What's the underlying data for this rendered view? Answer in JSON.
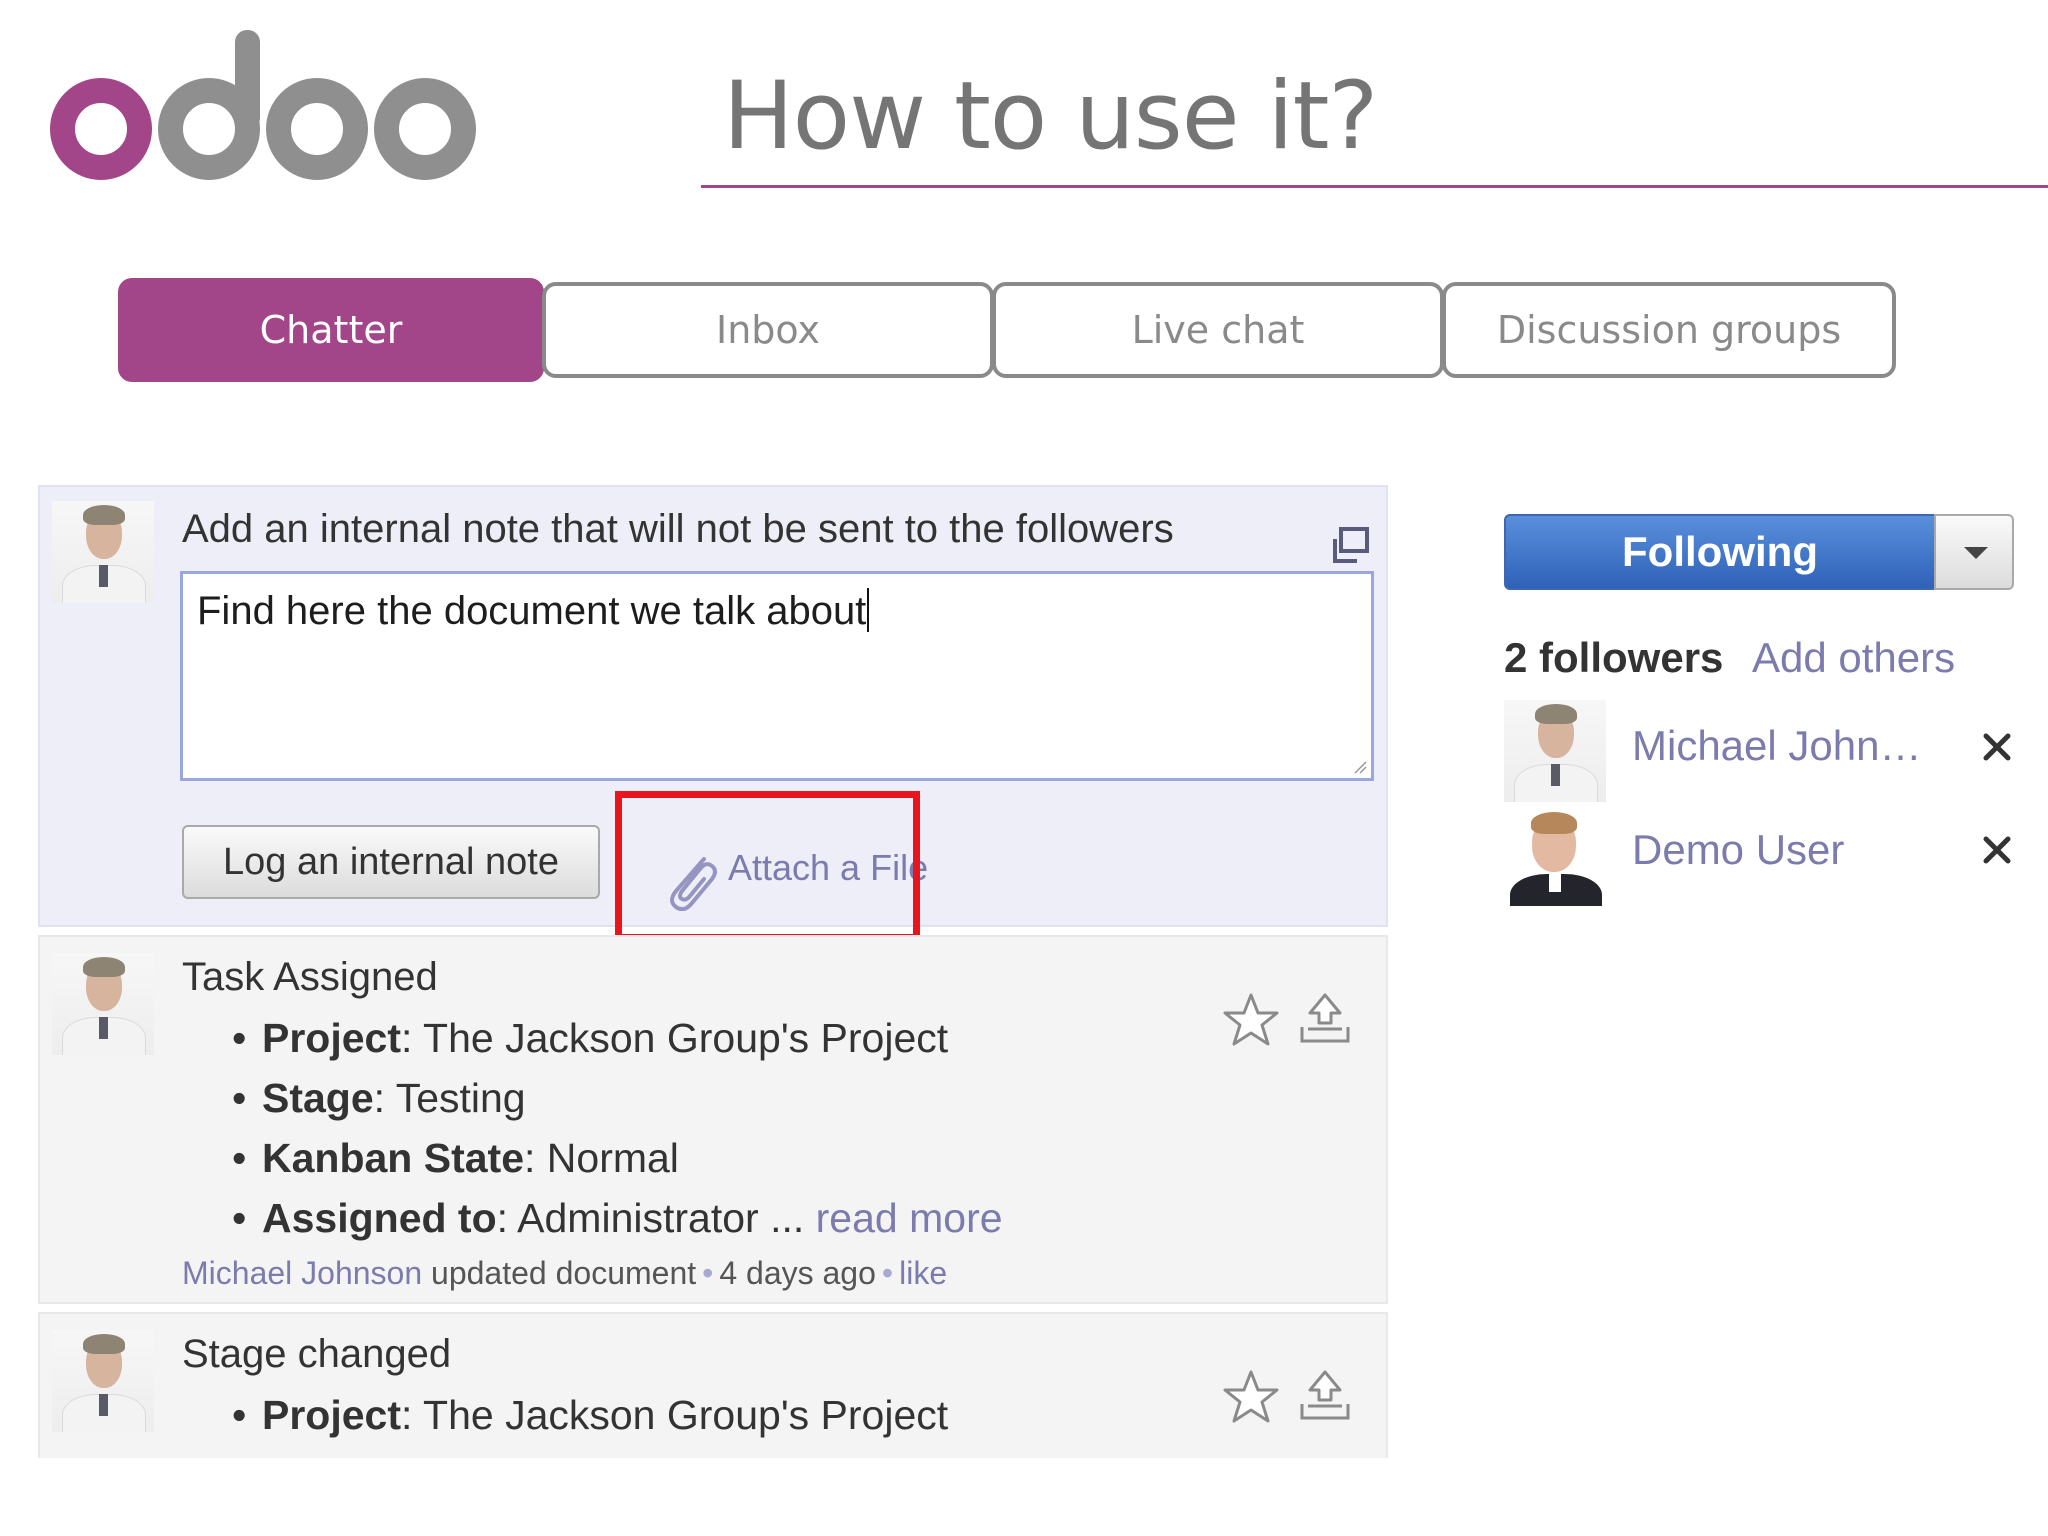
{
  "header": {
    "logo_text": "odoo",
    "title": "How to use it?"
  },
  "tabs": [
    {
      "label": "Chatter",
      "active": true
    },
    {
      "label": "Inbox",
      "active": false
    },
    {
      "label": "Live chat",
      "active": false
    },
    {
      "label": "Discussion groups",
      "active": false
    }
  ],
  "composer": {
    "heading": "Add an internal note that will not be sent to the followers",
    "note_value": "Find here the document we talk about",
    "log_button_label": "Log an internal note",
    "attach_label": "Attach a File"
  },
  "messages": [
    {
      "title": "Task Assigned",
      "fields": [
        {
          "key": "Project",
          "value": ": The Jackson Group's Project"
        },
        {
          "key": "Stage",
          "value": ": Testing"
        },
        {
          "key": "Kanban State",
          "value": ": Normal"
        },
        {
          "key": "Assigned to",
          "value": ": Administrator ..."
        }
      ],
      "read_more": "read more",
      "author": "Michael Johnson",
      "action": "updated document",
      "separator": "•",
      "time": "4 days ago",
      "like": "like"
    },
    {
      "title": "Stage changed",
      "fields": [
        {
          "key": "Project",
          "value": ": The Jackson Group's Project"
        }
      ]
    }
  ],
  "followers": {
    "follow_button_label": "Following",
    "count_label": "2 followers",
    "add_others_label": "Add others",
    "list": [
      {
        "name": "Michael John…"
      },
      {
        "name": "Demo User"
      }
    ]
  },
  "colors": {
    "brand": "#a24689",
    "link": "#7c7bad",
    "follow_button": "#2f62b8",
    "highlight": "#e8141e"
  },
  "icons": {
    "expand": "expand-window-icon",
    "attach": "paperclip-icon",
    "star": "star-icon",
    "reply": "reply-icon",
    "remove": "close-icon",
    "dropdown": "caret-down-icon"
  }
}
